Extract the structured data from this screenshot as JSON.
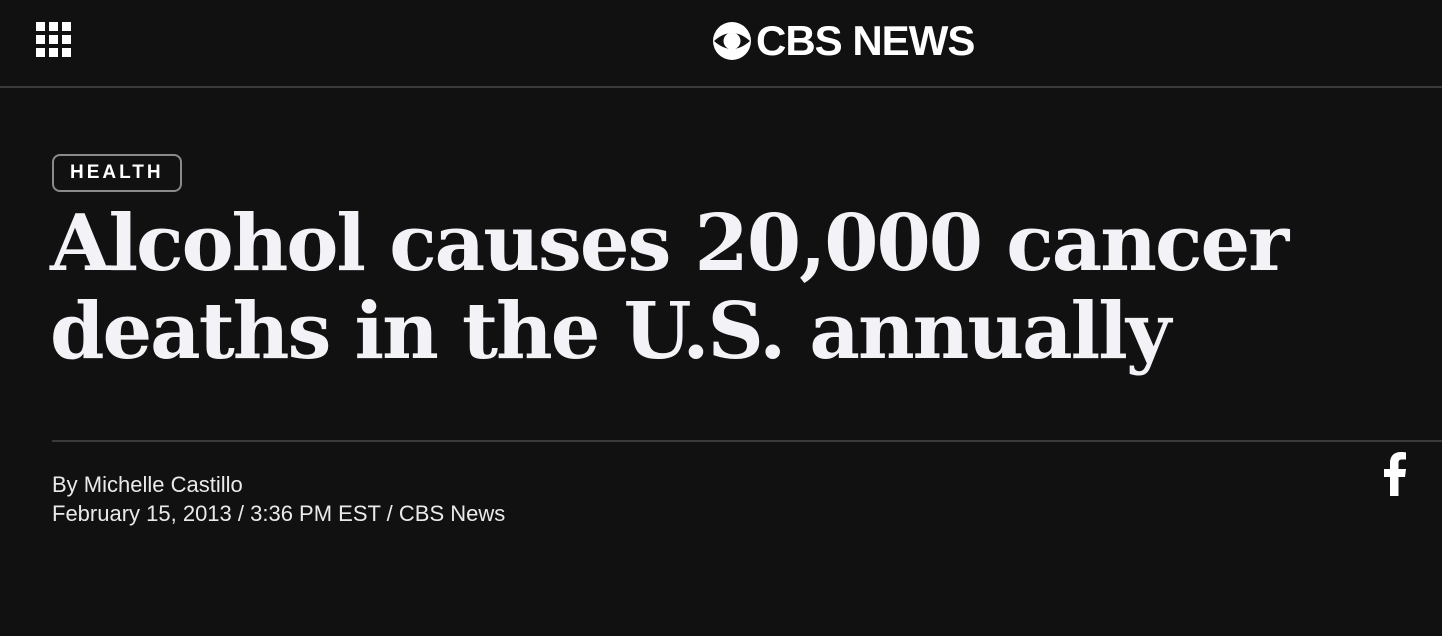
{
  "header": {
    "menu_icon": "grid-menu-icon",
    "logo_icon": "cbs-eye-icon",
    "logo_text": "CBS NEWS"
  },
  "article": {
    "category": "HEALTH",
    "title": "Alcohol causes 20,000 cancer deaths in the U.S. annually",
    "byline": "By Michelle Castillo",
    "dateline": "February 15, 2013 / 3:36 PM EST / CBS News"
  },
  "share": {
    "facebook_icon": "facebook-icon"
  },
  "colors": {
    "background": "#111111",
    "text": "#f3f3f7",
    "divider": "#3a3a3a",
    "tag_border": "#8a8a8a"
  }
}
